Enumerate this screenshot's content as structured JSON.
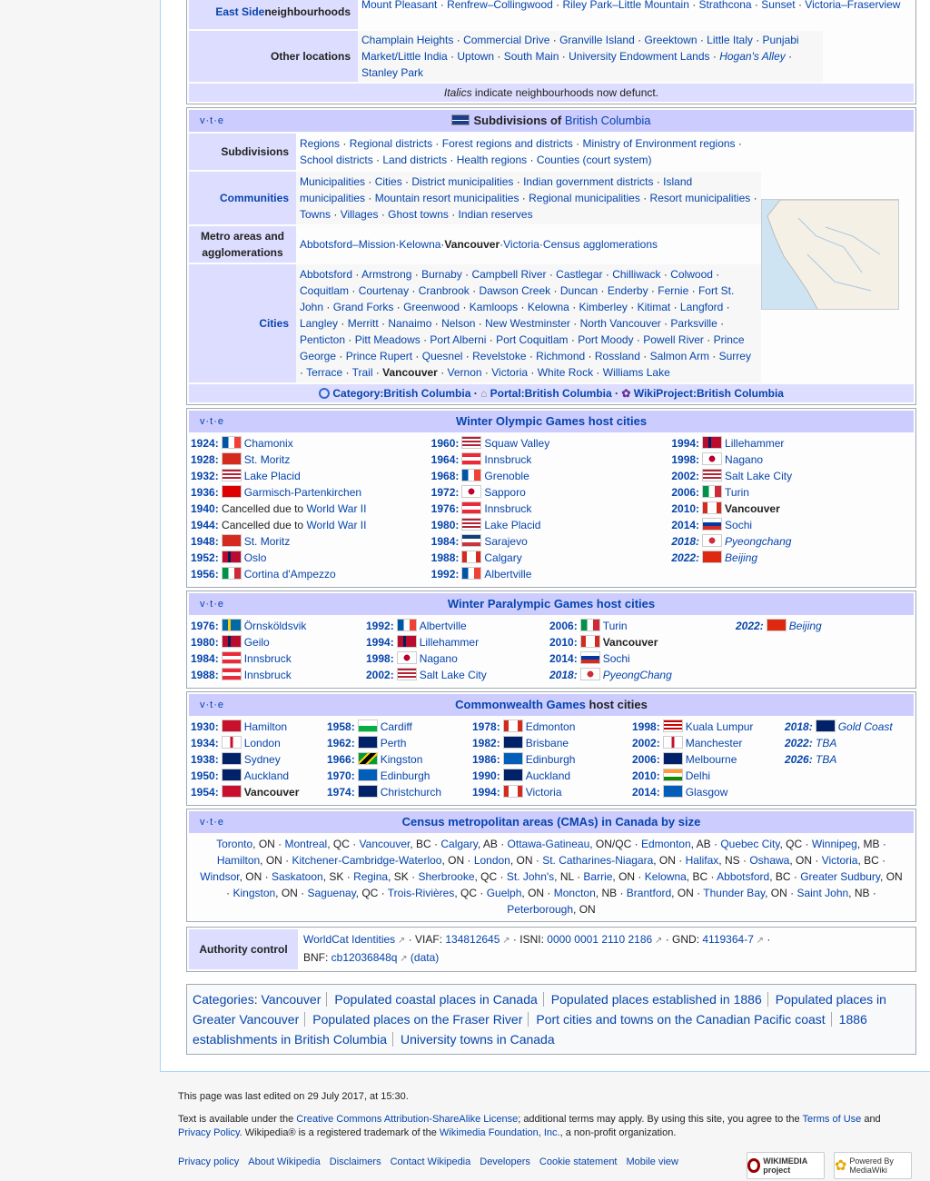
{
  "neighbourhoods": {
    "east_side_label": "East Side",
    "east_side_suffix": " neighbourhoods",
    "east_side_items": [
      "Mount Pleasant",
      "Renfrew–Collingwood",
      "Riley Park–Little Mountain",
      "Strathcona",
      "Sunset",
      "Victoria–Fraserview"
    ],
    "other_label": "Other locations",
    "other_items": [
      "Champlain Heights",
      "Commercial Drive",
      "Granville Island",
      "Greektown",
      "Little Italy",
      "Punjabi Market/Little India",
      "Uptown",
      "South Main",
      "University Endowment Lands",
      "Hogan's Alley",
      "Stanley Park"
    ],
    "note_italic": "Italics",
    "note_rest": " indicate neighbourhoods now defunct."
  },
  "vte": "v·t·e",
  "bc": {
    "title_prefix": "Subdivisions of ",
    "title_link": "British Columbia",
    "rows": [
      {
        "label": "Subdivisions",
        "items": [
          "Regions",
          "Regional districts",
          "Forest regions and districts",
          "Ministry of Environment regions",
          "School districts",
          "Land districts",
          "Health regions",
          "Counties (court system)"
        ]
      },
      {
        "label": "Communities",
        "items": [
          "Municipalities",
          "Cities",
          "District municipalities",
          "Indian government districts",
          "Island municipalities",
          "Mountain resort municipalities",
          "Regional municipalities",
          "Resort municipalities",
          "Towns",
          "Villages",
          "Ghost towns",
          "Indian reserves"
        ]
      },
      {
        "label": "Metro areas and agglomerations",
        "items": [
          "Abbotsford–Mission",
          "Kelowna",
          "Vancouver",
          "Victoria",
          "Census agglomerations"
        ]
      },
      {
        "label": "Cities",
        "items": [
          "Abbotsford",
          "Armstrong",
          "Burnaby",
          "Campbell River",
          "Castlegar",
          "Chilliwack",
          "Colwood",
          "Coquitlam",
          "Courtenay",
          "Cranbrook",
          "Dawson Creek",
          "Duncan",
          "Enderby",
          "Fernie",
          "Fort St. John",
          "Grand Forks",
          "Greenwood",
          "Kamloops",
          "Kelowna",
          "Kimberley",
          "Kitimat",
          "Langford",
          "Langley",
          "Merritt",
          "Nanaimo",
          "Nelson",
          "New Westminster",
          "North Vancouver",
          "Parksville",
          "Penticton",
          "Pitt Meadows",
          "Port Alberni",
          "Port Coquitlam",
          "Port Moody",
          "Powell River",
          "Prince George",
          "Prince Rupert",
          "Quesnel",
          "Revelstoke",
          "Richmond",
          "Rossland",
          "Salmon Arm",
          "Surrey",
          "Terrace",
          "Trail",
          "Vancouver",
          "Vernon",
          "Victoria",
          "White Rock",
          "Williams Lake"
        ]
      }
    ],
    "footer": [
      "Category:British Columbia",
      "Portal:British Columbia",
      "WikiProject:British Columbia"
    ]
  },
  "winter": {
    "title": "Winter Olympic Games host cities",
    "cols": [
      [
        [
          "1924:",
          "Chamonix",
          "fr"
        ],
        [
          "1928:",
          "St. Moritz",
          "ch"
        ],
        [
          "1932:",
          "Lake Placid",
          "us"
        ],
        [
          "1936:",
          "Garmisch-Partenkirchen",
          "de"
        ],
        [
          "1940:",
          "Cancelled due to ",
          "none",
          "World War II"
        ],
        [
          "1944:",
          "Cancelled due to ",
          "none",
          "World War II"
        ],
        [
          "1948:",
          "St. Moritz",
          "ch"
        ],
        [
          "1952:",
          "Oslo",
          "no"
        ],
        [
          "1956:",
          "Cortina d'Ampezzo",
          "it"
        ]
      ],
      [
        [
          "1960:",
          "Squaw Valley",
          "us"
        ],
        [
          "1964:",
          "Innsbruck",
          "at"
        ],
        [
          "1968:",
          "Grenoble",
          "fr"
        ],
        [
          "1972:",
          "Sapporo",
          "jp"
        ],
        [
          "1976:",
          "Innsbruck",
          "at"
        ],
        [
          "1980:",
          "Lake Placid",
          "us"
        ],
        [
          "1984:",
          "Sarajevo",
          "yu"
        ],
        [
          "1988:",
          "Calgary",
          "ca"
        ],
        [
          "1992:",
          "Albertville",
          "fr"
        ]
      ],
      [
        [
          "1994:",
          "Lillehammer",
          "no"
        ],
        [
          "1998:",
          "Nagano",
          "jp"
        ],
        [
          "2002:",
          "Salt Lake City",
          "us"
        ],
        [
          "2006:",
          "Turin",
          "it"
        ],
        [
          "2010:",
          "Vancouver",
          "ca"
        ],
        [
          "2014:",
          "Sochi",
          "ru"
        ],
        [
          "2018:",
          "Pyeongchang",
          "kr"
        ],
        [
          "2022:",
          "Beijing",
          "cn"
        ]
      ]
    ]
  },
  "paralympic": {
    "title": "Winter Paralympic Games",
    "title_rest": " host cities",
    "cols": [
      [
        [
          "1976:",
          "Örnsköldsvik",
          "se"
        ],
        [
          "1980:",
          "Geilo",
          "no"
        ],
        [
          "1984:",
          "Innsbruck",
          "at"
        ],
        [
          "1988:",
          "Innsbruck",
          "at"
        ]
      ],
      [
        [
          "1992:",
          "Albertville",
          "fr"
        ],
        [
          "1994:",
          "Lillehammer",
          "no"
        ],
        [
          "1998:",
          "Nagano",
          "jp"
        ],
        [
          "2002:",
          "Salt Lake City",
          "us"
        ]
      ],
      [
        [
          "2006:",
          "Turin",
          "it"
        ],
        [
          "2010:",
          "Vancouver",
          "ca"
        ],
        [
          "2014:",
          "Sochi",
          "ru"
        ],
        [
          "2018:",
          "PyeongChang",
          "kr"
        ]
      ],
      [
        [
          "2022:",
          "Beijing",
          "cn"
        ]
      ]
    ]
  },
  "commonwealth": {
    "title": "Commonwealth Games",
    "title_rest": " host cities",
    "cols": [
      [
        [
          "1930:",
          "Hamilton",
          "cared"
        ],
        [
          "1934:",
          "London",
          "en"
        ],
        [
          "1938:",
          "Sydney",
          "au"
        ],
        [
          "1950:",
          "Auckland",
          "nz"
        ],
        [
          "1954:",
          "Vancouver",
          "cared"
        ]
      ],
      [
        [
          "1958:",
          "Cardiff",
          "wa"
        ],
        [
          "1962:",
          "Perth",
          "au"
        ],
        [
          "1966:",
          "Kingston",
          "jm"
        ],
        [
          "1970:",
          "Edinburgh",
          "sc"
        ],
        [
          "1974:",
          "Christchurch",
          "nz"
        ]
      ],
      [
        [
          "1978:",
          "Edmonton",
          "ca"
        ],
        [
          "1982:",
          "Brisbane",
          "au"
        ],
        [
          "1986:",
          "Edinburgh",
          "sc"
        ],
        [
          "1990:",
          "Auckland",
          "nz"
        ],
        [
          "1994:",
          "Victoria",
          "ca"
        ]
      ],
      [
        [
          "1998:",
          "Kuala Lumpur",
          "my"
        ],
        [
          "2002:",
          "Manchester",
          "en"
        ],
        [
          "2006:",
          "Melbourne",
          "au"
        ],
        [
          "2010:",
          "Delhi",
          "in"
        ],
        [
          "2014:",
          "Glasgow",
          "sc"
        ]
      ],
      [
        [
          "2018:",
          "Gold Coast",
          "au"
        ],
        [
          "2022:",
          "TBA",
          "none"
        ],
        [
          "2026:",
          "TBA",
          "none"
        ]
      ]
    ]
  },
  "cma": {
    "title": "Census metropolitan areas (CMAs) in Canada by size",
    "items": [
      [
        "Toronto",
        ", ON"
      ],
      [
        "Montreal",
        ", QC"
      ],
      [
        "Vancouver",
        ", BC"
      ],
      [
        "Calgary",
        ", AB"
      ],
      [
        "Ottawa-Gatineau",
        ", ON/QC"
      ],
      [
        "Edmonton",
        ", AB"
      ],
      [
        "Quebec City",
        ", QC"
      ],
      [
        "Winnipeg",
        ", MB"
      ],
      [
        "Hamilton",
        ", ON"
      ],
      [
        "Kitchener-Cambridge-Waterloo",
        ", ON"
      ],
      [
        "London",
        ", ON"
      ],
      [
        "St. Catharines-Niagara",
        ", ON"
      ],
      [
        "Halifax",
        ", NS"
      ],
      [
        "Oshawa",
        ", ON"
      ],
      [
        "Victoria",
        ", BC"
      ],
      [
        "Windsor",
        ", ON"
      ],
      [
        "Saskatoon",
        ", SK"
      ],
      [
        "Regina",
        ", SK"
      ],
      [
        "Sherbrooke",
        ", QC"
      ],
      [
        "St. John's",
        ", NL"
      ],
      [
        "Barrie",
        ", ON"
      ],
      [
        "Kelowna",
        ", BC"
      ],
      [
        "Abbotsford",
        ", BC"
      ],
      [
        "Greater Sudbury",
        ", ON"
      ],
      [
        "Kingston",
        ", ON"
      ],
      [
        "Saguenay",
        ", QC"
      ],
      [
        "Trois-Rivières",
        ", QC"
      ],
      [
        "Guelph",
        ", ON"
      ],
      [
        "Moncton",
        ", NB"
      ],
      [
        "Brantford",
        ", ON"
      ],
      [
        "Thunder Bay",
        ", ON"
      ],
      [
        "Saint John",
        ", NB"
      ],
      [
        "Peterborough",
        ", ON"
      ]
    ]
  },
  "authority": {
    "label": "Authority control",
    "line1": [
      [
        "WorldCat Identities",
        ""
      ],
      [
        "VIAF: ",
        "134812645"
      ],
      [
        "ISNI: ",
        "0000 0001 2110 2186"
      ],
      [
        "GND: ",
        "4119364-7"
      ]
    ],
    "line2_prefix": "BNF: ",
    "line2_link": "cb12036848q",
    "line2_data": " (data)"
  },
  "categories": {
    "label": "Categories",
    "items": [
      "Vancouver",
      "Populated coastal places in Canada",
      "Populated places established in 1886",
      "Populated places in Greater Vancouver",
      "Populated places on the Fraser River",
      "Port cities and towns on the Canadian Pacific coast",
      "1886 establishments in British Columbia",
      "University towns in Canada"
    ]
  },
  "footer": {
    "last_edited": "This page was last edited on 29 July 2017, at 15:30.",
    "license_1": "Text is available under the ",
    "license_link": "Creative Commons Attribution-ShareAlike License",
    "license_2": "; additional terms may apply. By using this site, you agree to the ",
    "terms_link": "Terms of Use",
    "license_3": " and ",
    "privacy_link": "Privacy Policy",
    "license_4": ". Wikipedia® is a registered trademark of the ",
    "wmf_link": "Wikimedia Foundation, Inc.",
    "license_5": ", a non-profit organization.",
    "links": [
      "Privacy policy",
      "About Wikipedia",
      "Disclaimers",
      "Contact Wikipedia",
      "Developers",
      "Cookie statement",
      "Mobile view"
    ],
    "wikimedia_badge": "WIKIMEDIA project",
    "mediawiki_badge": "Powered By MediaWiki"
  }
}
